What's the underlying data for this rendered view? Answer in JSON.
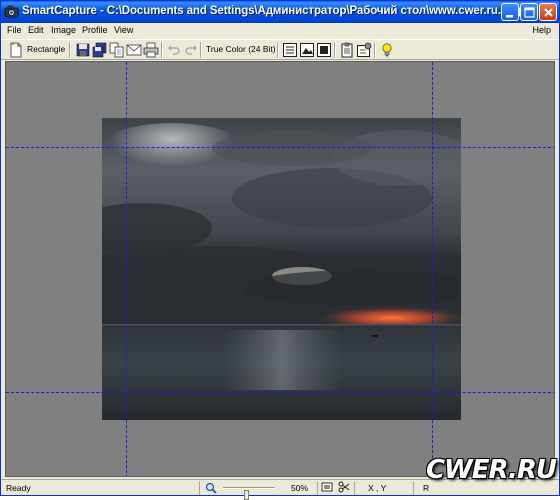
{
  "window": {
    "title": "SmartCapture - C:\\Documents and Settings\\Администратор\\Рабочий стол\\www.cwer.ru.bmp"
  },
  "menu": {
    "items": [
      "File",
      "Edit",
      "Image",
      "Profile",
      "View"
    ],
    "help": "Help"
  },
  "toolbar": {
    "capture_mode": "Rectangle",
    "color_depth": "True Color (24 Bit)"
  },
  "statusbar": {
    "status": "Ready",
    "zoom": "50%",
    "zoom_fraction": 0.45,
    "coords": "X , Y",
    "rgb_label": "R"
  },
  "watermark": "CWER.RU",
  "colors": {
    "titlebar": "#0058E6",
    "chrome": "#ECE9D8",
    "canvas": "#808080",
    "guides": "#1A1AEE"
  }
}
